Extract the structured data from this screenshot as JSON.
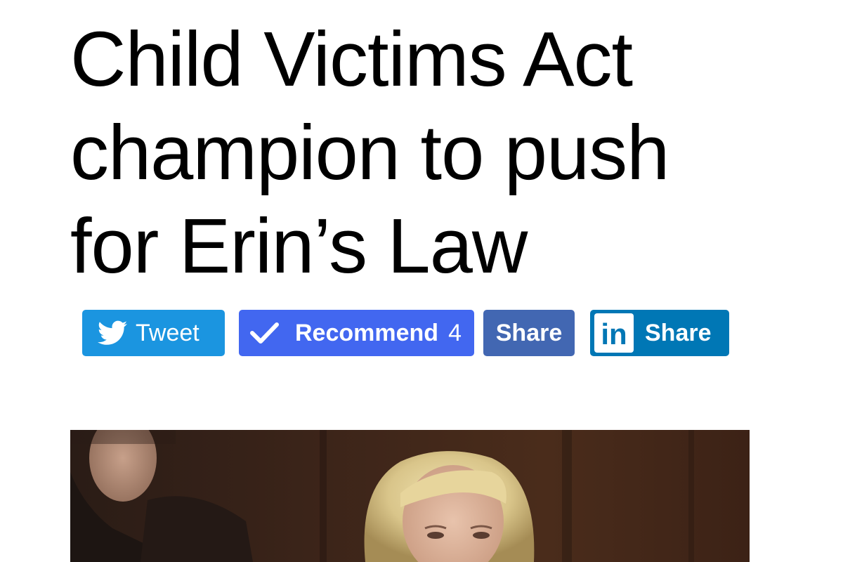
{
  "article": {
    "headline_lines": [
      "Child Victims Act",
      "champion to push",
      "for Erin’s Law"
    ]
  },
  "share": {
    "tweet": {
      "label": "Tweet",
      "icon": "twitter-bird-icon",
      "color": "#1b95e0"
    },
    "recommend": {
      "label": "Recommend",
      "count": "4",
      "icon": "checkmark-icon",
      "color": "#4267f0"
    },
    "facebook": {
      "label": "Share",
      "color": "#4267b2"
    },
    "linkedin": {
      "label": "Share",
      "icon_text": "in",
      "icon": "linkedin-icon",
      "color": "#0077b5"
    }
  },
  "hero_image": {
    "subject": "photo"
  }
}
